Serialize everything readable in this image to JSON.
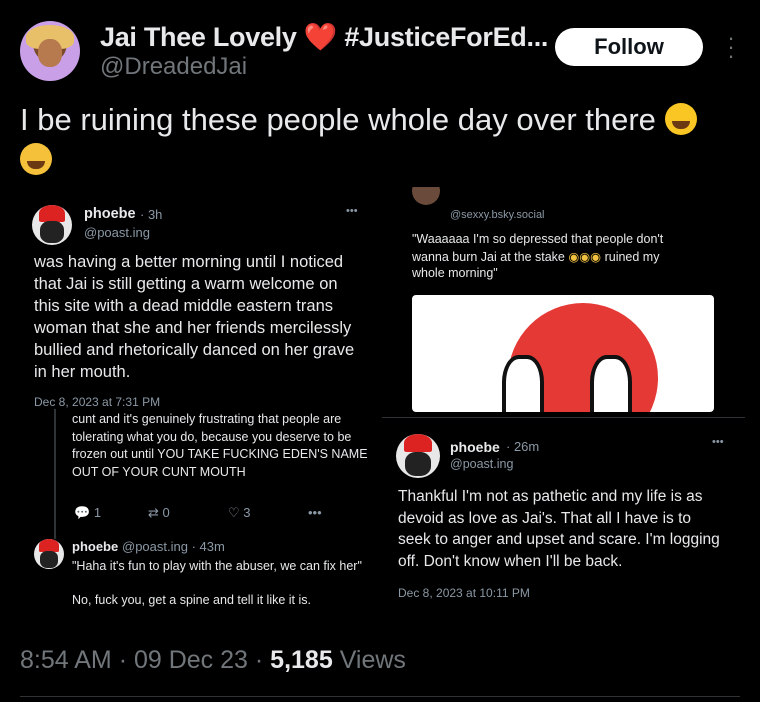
{
  "author": {
    "display_name": "Jai Thee Lovely",
    "heart": "❤️",
    "hashtag": "#JusticeForEd...",
    "handle": "@DreadedJai",
    "follow_label": "Follow",
    "more_icon": "kebab-vertical-icon"
  },
  "tweet": {
    "text": "I be ruining these people whole day over there",
    "emojis": [
      "face-with-tears-of-joy",
      "loudly-crying-face"
    ]
  },
  "media": {
    "card_a": {
      "name": "phoebe",
      "time": "· 3h",
      "handle": "@poast.ing",
      "more": "•••",
      "body": "was having a better morning until I noticed that Jai is still getting a warm welcome on this site with a dead middle eastern trans woman that she and her friends mercilessly bullied and rhetorically danced on her grave in her mouth.",
      "timestamp": "Dec 8, 2023 at 7:31 PM",
      "reply_body": "cunt and it's genuinely frustrating that people are tolerating what you do, because you deserve to be frozen out until YOU TAKE FUCKING EDEN'S NAME OUT OF YOUR CUNT MOUTH",
      "reply_count": "1",
      "repost_count": "0",
      "like_count": "3",
      "reply2_name": "phoebe",
      "reply2_handle": "@poast.ing · 43m",
      "reply2_body1": "\"Haha it's fun to play with the abuser, we can fix her\"",
      "reply2_body2": "No, fuck you, get a spine and tell it like it is."
    },
    "card_b": {
      "handle": "@sexxy.bsky.social",
      "quote_line1": "\"Waaaaaa I'm so depressed that people don't",
      "quote_line2": "wanna burn Jai at the stake",
      "quote_line2_end": "ruined my",
      "quote_line3": "whole morning\""
    },
    "card_c": {
      "name": "phoebe",
      "time": "· 26m",
      "handle": "@poast.ing",
      "more": "•••",
      "body": "Thankful I'm not as pathetic and my life is as devoid as love as Jai's. That all I have is to seek to anger and upset and scare. I'm logging off. Don't know when I'll be back.",
      "timestamp": "Dec 8, 2023 at 10:11 PM"
    }
  },
  "footer": {
    "time": "8:54 AM",
    "sep1": "·",
    "date": "09 Dec 23",
    "sep2": "·",
    "views_count": "5,185",
    "views_label": "Views"
  }
}
